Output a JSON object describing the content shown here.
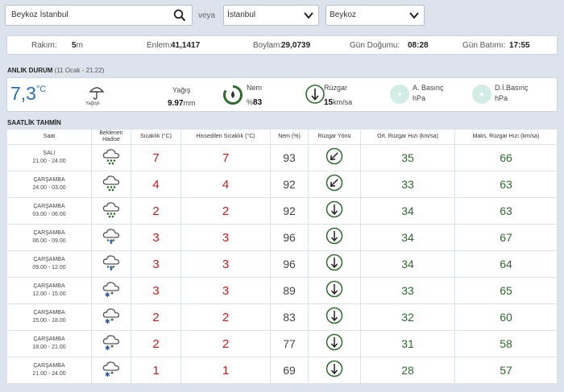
{
  "search": {
    "value": "Beykoz İstanbul",
    "separator": "veya",
    "province": "İstanbul",
    "district": "Beykoz"
  },
  "info": {
    "altitude_label": "Rakım:",
    "altitude_value": "5",
    "altitude_unit": "m",
    "lat_label": "Enlem:",
    "lat_value": "41,1417",
    "lon_label": "Boylam:",
    "lon_value": "29,0739",
    "sunrise_label": "Gün Doğumu:",
    "sunrise_value": "08:28",
    "sunset_label": "Gün Batımı:",
    "sunset_value": "17:55"
  },
  "current": {
    "title": "ANLIK DURUM",
    "subtitle": "(11 Ocak - 21.22)",
    "temp": "7,3",
    "temp_unit": "°C",
    "condition": "Yağışlı",
    "precip_label": "Yağış",
    "precip_value": "9.97",
    "precip_unit": "mm",
    "humidity_label": "Nem",
    "humidity_prefix": "%",
    "humidity_value": "83",
    "wind_label": "Rüzgar",
    "wind_value": "15",
    "wind_unit": "km/sa",
    "pressure_label": "A. Basınç",
    "pressure_unit": "hPa",
    "sealevel_label": "D.İ.Basınç",
    "sealevel_unit": "hPa"
  },
  "hourly": {
    "title": "SAATLİK TAHMİN",
    "headers": [
      "Saat",
      "Beklenen Hadise",
      "Sıcaklık (°C)",
      "Hissedilen Sıcaklık (°C)",
      "Nem (%)",
      "Rüzgar Yönü",
      "Ort. Rüzgar Hızı (km/sa)",
      "Maks. Rüzgar Hızı (km/sa)"
    ],
    "rows": [
      {
        "day": "SALI",
        "time": "21.00 - 24.00",
        "icon": "rain-cloud-icon",
        "temp": "7",
        "feels": "7",
        "humidity": "93",
        "wind_dir": "sw",
        "avg": "35",
        "max": "66"
      },
      {
        "day": "ÇARŞAMBA",
        "time": "24.00 - 03.00",
        "icon": "rain-cloud-icon",
        "temp": "4",
        "feels": "4",
        "humidity": "92",
        "wind_dir": "sw",
        "avg": "33",
        "max": "63"
      },
      {
        "day": "ÇARŞAMBA",
        "time": "03.00 - 06.00",
        "icon": "rain-cloud-icon",
        "temp": "2",
        "feels": "2",
        "humidity": "92",
        "wind_dir": "s",
        "avg": "34",
        "max": "63"
      },
      {
        "day": "ÇARŞAMBA",
        "time": "06.00 - 09.00",
        "icon": "sleet-cloud-icon",
        "temp": "3",
        "feels": "3",
        "humidity": "96",
        "wind_dir": "s",
        "avg": "34",
        "max": "67"
      },
      {
        "day": "ÇARŞAMBA",
        "time": "09.00 - 12.00",
        "icon": "sleet-cloud-icon",
        "temp": "3",
        "feels": "3",
        "humidity": "96",
        "wind_dir": "s",
        "avg": "34",
        "max": "64"
      },
      {
        "day": "ÇARŞAMBA",
        "time": "12.00 - 15.00",
        "icon": "snow-cloud-icon",
        "temp": "3",
        "feels": "3",
        "humidity": "89",
        "wind_dir": "s",
        "avg": "33",
        "max": "65"
      },
      {
        "day": "ÇARŞAMBA",
        "time": "15.00 - 18.00",
        "icon": "snow-cloud-icon",
        "temp": "2",
        "feels": "2",
        "humidity": "83",
        "wind_dir": "s",
        "avg": "32",
        "max": "60"
      },
      {
        "day": "ÇARŞAMBA",
        "time": "18.00 - 21.00",
        "icon": "snow-cloud-icon",
        "temp": "2",
        "feels": "2",
        "humidity": "77",
        "wind_dir": "s",
        "avg": "31",
        "max": "58"
      },
      {
        "day": "ÇARŞAMBA",
        "time": "21.00 - 24.00",
        "icon": "snow-cloud-icon",
        "temp": "1",
        "feels": "1",
        "humidity": "69",
        "wind_dir": "s",
        "avg": "28",
        "max": "57"
      }
    ]
  },
  "colors": {
    "temp_red": "#cc1a1a",
    "wind_green": "#2e6b2e",
    "current_blue": "#2a6db5",
    "background": "#dde3ec"
  }
}
